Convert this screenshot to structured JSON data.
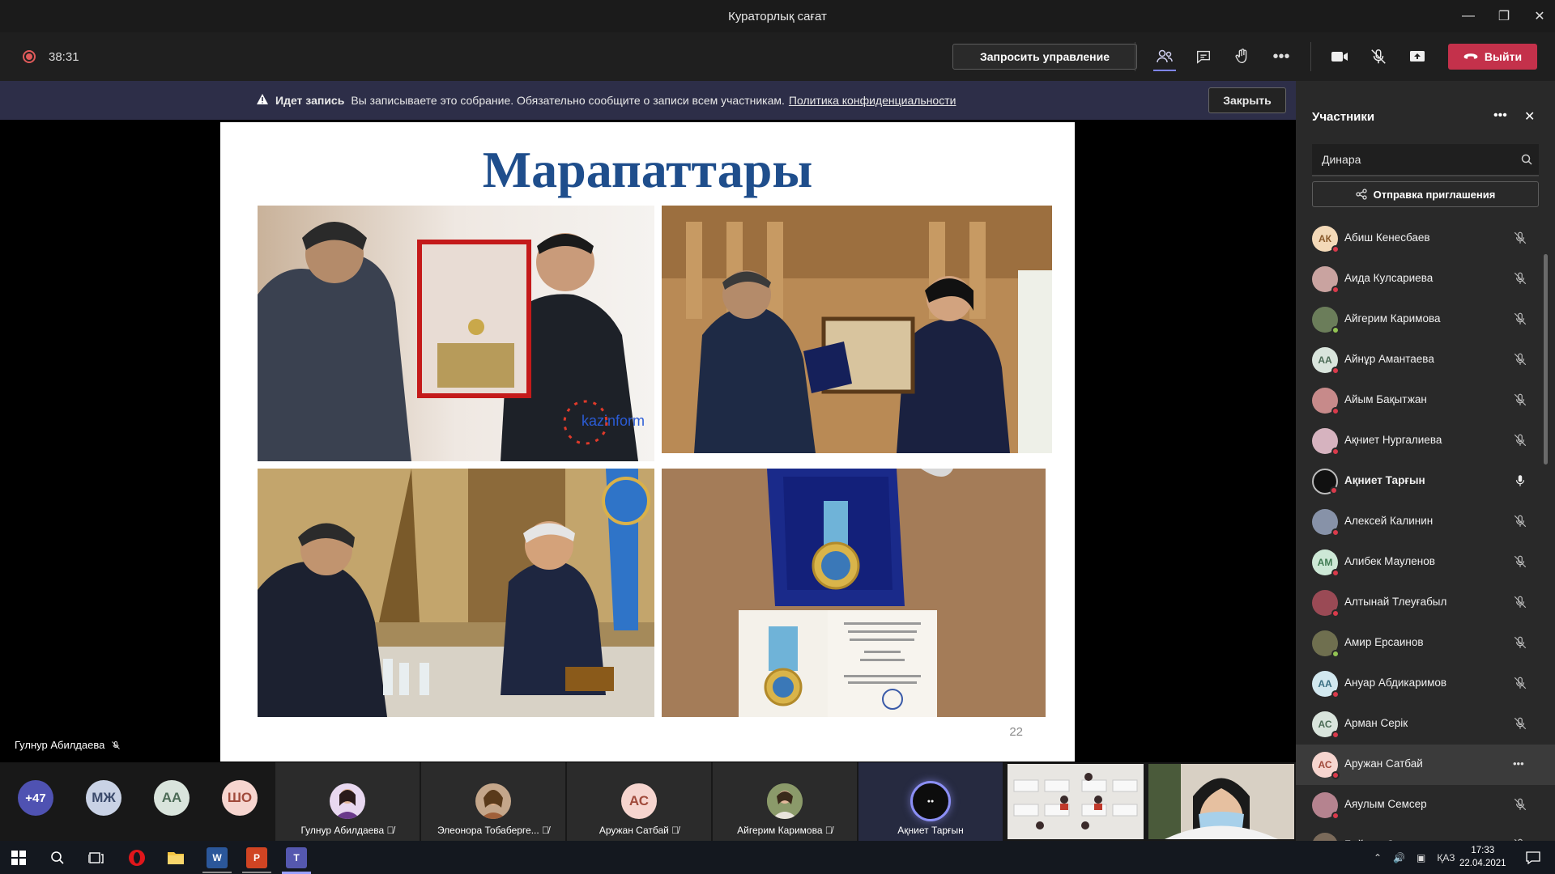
{
  "window": {
    "title": "Кураторлық сағат"
  },
  "toolbar": {
    "timer": "38:31",
    "request_control": "Запросить управление",
    "leave": "Выйти"
  },
  "banner": {
    "title": "Идет запись",
    "message": "Вы записываете это собрание. Обязательно сообщите о записи всем участникам.",
    "link": "Политика конфиденциальности",
    "close": "Закрыть"
  },
  "slide": {
    "title": "Марапаттары",
    "page_number": "22",
    "watermark": "kazinform"
  },
  "stage": {
    "speaker": "Гулнур Абилдаева"
  },
  "strip": {
    "overflow": "+47",
    "avatars": [
      "МЖ",
      "АА",
      "ШО"
    ],
    "tiles": [
      {
        "name": "Гулнур Абилдаева"
      },
      {
        "name": "Элеонора Тобаберге..."
      },
      {
        "name": "Аружан Сатбай",
        "initials": "АС"
      },
      {
        "name": "Айгерим Каримова"
      },
      {
        "name": "Ақниет Тарғын"
      }
    ]
  },
  "panel": {
    "title": "Участники",
    "search_value": "Динара",
    "invite": "Отправка приглашения",
    "participants": [
      {
        "name": "Абиш Кенесбаев",
        "initials": "АК",
        "color": "#f3d9b8",
        "fg": "#8a5a2b"
      },
      {
        "name": "Аида Кулсариева",
        "initials": "",
        "color": "#c9a3a0",
        "fg": "#fff"
      },
      {
        "name": "Айгерим Каримова",
        "initials": "",
        "color": "#6b7d5a",
        "fg": "#fff"
      },
      {
        "name": "Айнұр Амантаева",
        "initials": "АА",
        "color": "#d9e4dc",
        "fg": "#4c6b56"
      },
      {
        "name": "Айым Бақытжан",
        "initials": "",
        "color": "#c78a8a",
        "fg": "#fff"
      },
      {
        "name": "Ақниет Нургалиева",
        "initials": "",
        "color": "#d6b3bf",
        "fg": "#fff"
      },
      {
        "name": "Ақниет Тарғын",
        "initials": "",
        "color": "#111111",
        "fg": "#fff"
      },
      {
        "name": "Алексей Калинин",
        "initials": "",
        "color": "#8792a8",
        "fg": "#fff"
      },
      {
        "name": "Алибек Мауленов",
        "initials": "АМ",
        "color": "#cde8d6",
        "fg": "#3f7a52"
      },
      {
        "name": "Алтынай Тлеуғабыл",
        "initials": "",
        "color": "#9a4a55",
        "fg": "#fff"
      },
      {
        "name": "Амир Ерсаинов",
        "initials": "",
        "color": "#6f6f4f",
        "fg": "#fff"
      },
      {
        "name": "Ануар Абдикаримов",
        "initials": "АА",
        "color": "#d2e8ef",
        "fg": "#3a6f82"
      },
      {
        "name": "Арман Серік",
        "initials": "АС",
        "color": "#d9e4dc",
        "fg": "#4c6b56"
      },
      {
        "name": "Аружан Сатбай",
        "initials": "АС",
        "color": "#f6d5cf",
        "fg": "#a04a3b"
      },
      {
        "name": "Аяулым Семсер",
        "initials": "",
        "color": "#b5838f",
        "fg": "#fff"
      },
      {
        "name": "Байжан Сагиева",
        "initials": "",
        "color": "#7a6a5a",
        "fg": "#fff"
      }
    ]
  },
  "taskbar": {
    "lang": "ҚАЗ",
    "time": "17:33",
    "date": "22.04.2021"
  },
  "colors": {
    "accent": "#6264a7",
    "leave": "#c4314b",
    "title_blue": "#1f4e8c"
  }
}
